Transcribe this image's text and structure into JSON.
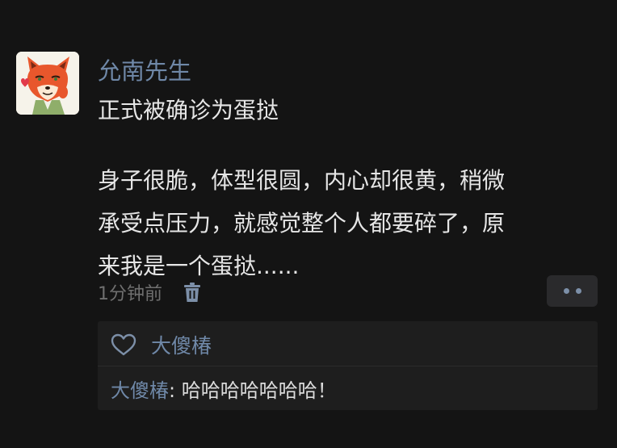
{
  "post": {
    "author": "允南先生",
    "title_line": "正式被确诊为蛋挞",
    "body_lines": [
      "身子很脆，体型很圆，内心却很黄，稍微",
      "承受点压力，就感觉整个人都要碎了，原",
      "来我是一个蛋挞......"
    ],
    "timestamp": "1分钟前",
    "delete_icon": "trash-icon",
    "more_icon": "ellipsis-icon"
  },
  "likes": {
    "icon": "heart-outline-icon",
    "names": "大傻椿"
  },
  "comments": [
    {
      "author": "大傻椿",
      "separator": ": ",
      "text": "哈哈哈哈哈哈哈！"
    }
  ],
  "colors": {
    "background": "#141414",
    "name_blue": "#6f88a8",
    "body_text": "#e6e6e6",
    "muted": "#6f6f6f",
    "panel": "#1e1e1e",
    "avatar_fox": "#e8572c"
  }
}
